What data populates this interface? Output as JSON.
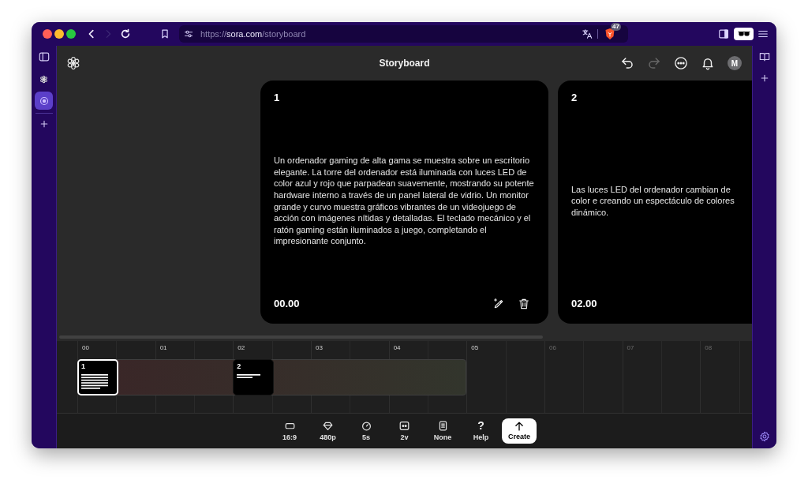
{
  "browser": {
    "nav": [
      {
        "kind": "back",
        "disabled": false
      },
      {
        "kind": "forward",
        "disabled": true
      },
      {
        "kind": "reload",
        "disabled": false
      }
    ],
    "url": {
      "scheme": "https://",
      "host": "sora.com",
      "path": "/storyboard"
    },
    "shield_badge": "47"
  },
  "left_sidebar": {
    "apps": [
      {
        "kind": "flower",
        "selected": false
      },
      {
        "kind": "ring",
        "selected": true
      }
    ]
  },
  "header": {
    "title": "Storyboard",
    "history": [
      {
        "kind": "undo",
        "disabled": false
      },
      {
        "kind": "redo",
        "disabled": true
      }
    ],
    "avatar": "M"
  },
  "cards": [
    {
      "number": "1",
      "text": "Un ordenador gaming de alta gama se muestra sobre un escritorio elegante. La torre del ordenador está iluminada con luces LED de color azul y rojo que parpadean suavemente, mostrando su potente hardware interno a través de un panel lateral de vidrio. Un monitor grande y curvo muestra gráficos vibrantes de un videojuego de acción con imágenes nítidas y detalladas. El teclado mecánico y el ratón gaming están iluminados a juego, completando el impresionante conjunto.",
      "time": "00.00",
      "tools_visible": true
    },
    {
      "number": "2",
      "text": "Las luces LED del ordenador cambian de color e creando un espectáculo de colores dinámico.",
      "time": "02.00",
      "tools_visible": false
    }
  ],
  "timeline": {
    "ruler": [
      {
        "label": "00",
        "faded": false
      },
      {
        "label": "01",
        "faded": false
      },
      {
        "label": "02",
        "faded": false
      },
      {
        "label": "03",
        "faded": false
      },
      {
        "label": "04",
        "faded": false
      },
      {
        "label": "05",
        "faded": false
      },
      {
        "label": "06",
        "faded": true
      },
      {
        "label": "07",
        "faded": true
      },
      {
        "label": "08",
        "faded": true
      }
    ],
    "clips": [
      {
        "number": "1",
        "selected": true
      },
      {
        "number": "2",
        "selected": false
      }
    ]
  },
  "toolbar": {
    "options": [
      {
        "kind": "ratio",
        "label": "16:9"
      },
      {
        "kind": "quality",
        "label": "480p"
      },
      {
        "kind": "duration",
        "label": "5s"
      },
      {
        "kind": "variations",
        "label": "2v"
      },
      {
        "kind": "preset",
        "label": "None"
      },
      {
        "kind": "help",
        "label": "Help",
        "glyph": "?"
      }
    ],
    "create": {
      "label": "Create"
    }
  }
}
